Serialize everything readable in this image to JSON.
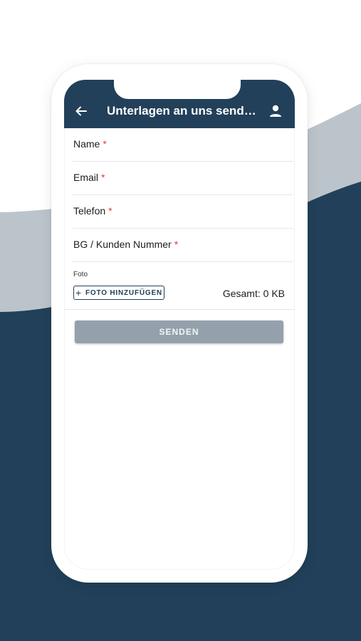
{
  "colors": {
    "brand": "#22405a",
    "wave_light": "#bcc4cb",
    "required": "#e53935",
    "button_disabled": "#94a1ad"
  },
  "appbar": {
    "title": "Unterlagen an uns send…",
    "back_icon": "arrow-left-icon",
    "account_icon": "user-icon"
  },
  "form": {
    "fields": [
      {
        "label": "Name",
        "required_mark": "*"
      },
      {
        "label": "Email",
        "required_mark": "*"
      },
      {
        "label": "Telefon",
        "required_mark": "*"
      },
      {
        "label": "BG / Kunden Nummer",
        "required_mark": "*"
      }
    ],
    "photo": {
      "label": "Foto",
      "add_button": "FOTO HINZUFÜGEN",
      "add_icon": "plus-icon",
      "total": "Gesamt: 0 KB"
    },
    "submit": "SENDEN"
  }
}
